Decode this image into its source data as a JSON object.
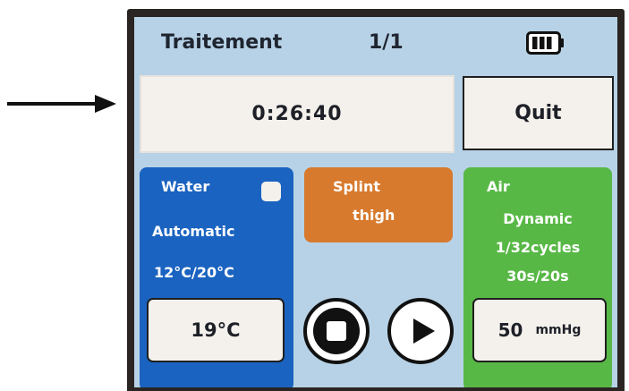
{
  "header": {
    "title": "Traitement",
    "page": "1/1",
    "battery_icon": "battery-icon"
  },
  "timer": {
    "value": "0:26:40"
  },
  "quit_label": "Quit",
  "water": {
    "label": "Water",
    "mode": "Automatic",
    "range": "12°C/20°C",
    "current_temp": "19°C"
  },
  "splint": {
    "label": "Splint",
    "location": "thigh"
  },
  "air": {
    "label": "Air",
    "mode": "Dynamic",
    "cycles": "1/32cycles",
    "timing": "30s/20s",
    "pressure_value": "50",
    "pressure_unit": "mmHg"
  },
  "controls": {
    "stop_icon": "stop-icon",
    "play_icon": "play-icon"
  },
  "colors": {
    "screen_bg": "#b7d2e6",
    "water": "#1a63c0",
    "splint": "#d77a2e",
    "air": "#58b846",
    "bezel": "#2a2522"
  }
}
